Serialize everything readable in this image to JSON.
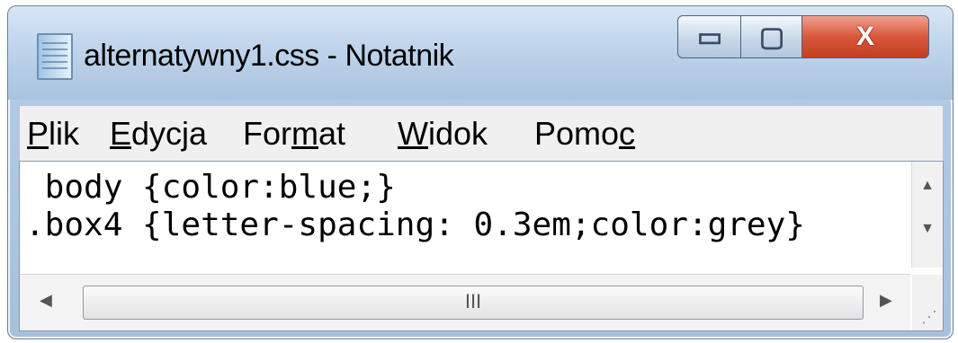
{
  "window": {
    "title": "alternatywny1.css - Notatnik",
    "minimize_symbol": "▭",
    "maximize_symbol": "▢",
    "close_symbol": "X"
  },
  "menu": [
    {
      "pre": "",
      "key": "P",
      "post": "lik"
    },
    {
      "pre": "",
      "key": "E",
      "post": "dycja"
    },
    {
      "pre": "For",
      "key": "m",
      "post": "at"
    },
    {
      "pre": "",
      "key": "W",
      "post": "idok"
    },
    {
      "pre": "Pomo",
      "key": "c",
      "post": ""
    }
  ],
  "editor": {
    "lines": [
      " body {color:blue;}",
      ".box4 {letter-spacing: 0.3em;color:grey}"
    ]
  },
  "scrollbar": {
    "vertical_up": "▲",
    "vertical_down": "▼",
    "horizontal_left": "◀",
    "horizontal_right": "▶",
    "thumb_grip": "III"
  }
}
